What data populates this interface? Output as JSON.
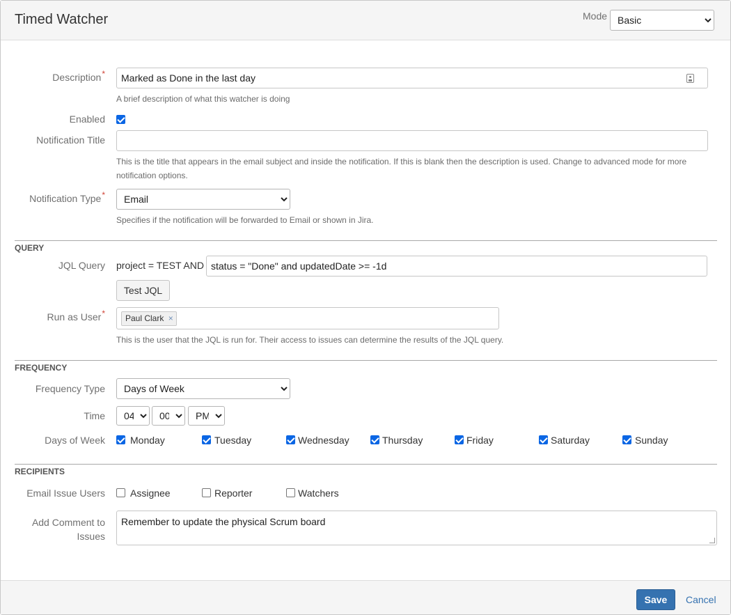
{
  "header": {
    "title": "Timed Watcher",
    "mode_label": "Mode",
    "mode_value": "Basic"
  },
  "form": {
    "description": {
      "label": "Description",
      "value": "Marked as Done in the last day",
      "hint": "A brief description of what this watcher is doing"
    },
    "enabled": {
      "label": "Enabled",
      "checked": true
    },
    "notification_title": {
      "label": "Notification Title",
      "value": "",
      "hint": "This is the title that appears in the email subject and inside the notification. If this is blank then the description is used. Change to advanced mode for more notification options."
    },
    "notification_type": {
      "label": "Notification Type",
      "value": "Email",
      "hint": "Specifies if the notification will be forwarded to Email or shown in Jira."
    }
  },
  "query": {
    "section_title": "QUERY",
    "jql_label": "JQL Query",
    "jql_prefix": "project = TEST AND",
    "jql_value": "status = \"Done\" and updatedDate >= -1d",
    "test_button": "Test JQL",
    "run_as_label": "Run as User",
    "run_as_user": "Paul Clark",
    "run_as_remove": "×",
    "run_as_hint": "This is the user that the JQL is run for. Their access to issues can determine the results of the JQL query."
  },
  "frequency": {
    "section_title": "FREQUENCY",
    "type_label": "Frequency Type",
    "type_value": "Days of Week",
    "time_label": "Time",
    "hour": "04",
    "minute": "00",
    "ampm": "PM",
    "days_label": "Days of Week",
    "days": [
      {
        "name": "Monday",
        "checked": true
      },
      {
        "name": "Tuesday",
        "checked": true
      },
      {
        "name": "Wednesday",
        "checked": true
      },
      {
        "name": "Thursday",
        "checked": true
      },
      {
        "name": "Friday",
        "checked": true
      },
      {
        "name": "Saturday",
        "checked": true
      },
      {
        "name": "Sunday",
        "checked": true
      }
    ]
  },
  "recipients": {
    "section_title": "RECIPIENTS",
    "email_users_label": "Email Issue Users",
    "users": [
      {
        "name": "Assignee",
        "checked": false
      },
      {
        "name": "Reporter",
        "checked": false
      },
      {
        "name": "Watchers",
        "checked": false
      }
    ],
    "comment_label_1": "Add Comment to",
    "comment_label_2": "Issues",
    "comment_value": "Remember to update the physical Scrum board"
  },
  "footer": {
    "save": "Save",
    "cancel": "Cancel"
  },
  "colors": {
    "primary": "#3572b0",
    "checkbox": "#0b66e4",
    "required": "#d04437"
  }
}
